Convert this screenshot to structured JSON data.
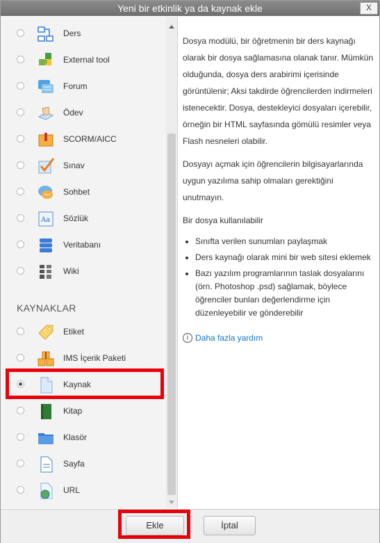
{
  "dialog": {
    "title": "Yeni bir etkinlik ya da kaynak ekle",
    "close_label": "X"
  },
  "activities": [
    {
      "label": "Ders",
      "icon": "lesson-icon",
      "selected": false
    },
    {
      "label": "External tool",
      "icon": "puzzle-icon",
      "selected": false
    },
    {
      "label": "Forum",
      "icon": "forum-icon",
      "selected": false
    },
    {
      "label": "Ödev",
      "icon": "assignment-icon",
      "selected": false
    },
    {
      "label": "SCORM/AICC",
      "icon": "scorm-package-icon",
      "selected": false
    },
    {
      "label": "Sınav",
      "icon": "quiz-checkmark-icon",
      "selected": false
    },
    {
      "label": "Sohbet",
      "icon": "chat-bubble-icon",
      "selected": false
    },
    {
      "label": "Sözlük",
      "icon": "glossary-icon",
      "selected": false
    },
    {
      "label": "Veritabanı",
      "icon": "database-icon",
      "selected": false
    },
    {
      "label": "Wiki",
      "icon": "wiki-icon",
      "selected": false
    }
  ],
  "resources_heading": "KAYNAKLAR",
  "resources": [
    {
      "label": "Etiket",
      "icon": "label-tag-icon",
      "selected": false
    },
    {
      "label": "IMS İçerik Paketi",
      "icon": "ims-package-icon",
      "selected": false
    },
    {
      "label": "Kaynak",
      "icon": "file-icon",
      "selected": true
    },
    {
      "label": "Kitap",
      "icon": "book-icon",
      "selected": false
    },
    {
      "label": "Klasör",
      "icon": "folder-icon",
      "selected": false
    },
    {
      "label": "Sayfa",
      "icon": "page-icon",
      "selected": false
    },
    {
      "label": "URL",
      "icon": "url-globe-icon",
      "selected": false
    }
  ],
  "description": {
    "para1": "Dosya modülü, bir öğretmenin bir ders kaynağı olarak bir dosya sağlamasına olanak tanır. Mümkün olduğunda, dosya ders arabirimi içerisinde görüntülenir; Aksi takdirde öğrencilerden indirmeleri istenecektir. Dosya, destekleyici dosyaları içerebilir, örneğin bir HTML sayfasında gömülü resimler veya Flash nesneleri olabilir.",
    "para2": "Dosyayı açmak için öğrencilerin bilgisayarlarında uygun yazılıma sahip olmaları gerektiğini unutmayın.",
    "para3": "Bir dosya kullanılabilir",
    "bullets": [
      "Sınıfta verilen sunumları paylaşmak",
      "Ders kaynağı olarak mini bir web sitesi eklemek",
      "Bazı yazılım programlarının taslak dosyalarını (örn. Photoshop .psd) sağlamak, böylece öğrenciler bunları değerlendirme için düzenleyebilir ve gönderebilir"
    ],
    "help_link": "Daha fazla yardım"
  },
  "footer": {
    "add_label": "Ekle",
    "cancel_label": "İptal"
  },
  "colors": {
    "highlight": "#e8000a",
    "link": "#1177d1",
    "titlebar": "#7a7a7a"
  }
}
